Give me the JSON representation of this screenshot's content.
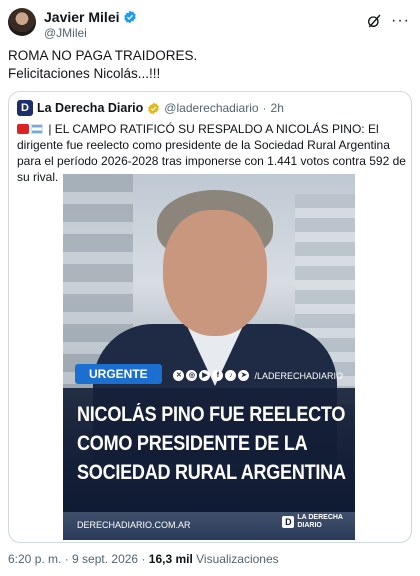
{
  "author": {
    "name": "Javier Milei",
    "handle": "@JMilei",
    "verified_color": "#1d9bf0"
  },
  "tweet": {
    "lines": [
      "ROMA NO PAGA TRAIDORES.",
      "Felicitaciones Nicolás...!!!"
    ]
  },
  "icons": {
    "grok": "grok-icon",
    "more": "more-icon",
    "verified": "verified-badge-icon"
  },
  "quote": {
    "name": "La Derecha Diario",
    "handle": "@laderechadiario",
    "separator": "·",
    "time": "2h",
    "badge_color": "#e2b719",
    "logo_letter": "D",
    "text": "| EL CAMPO RATIFICÓ SU RESPALDO A NICOLÁS PINO: El dirigente fue reelecto como presidente de la Sociedad Rural Argentina para el período 2026-2028 tras imponerse con 1.441 votos contra 592 de su rival.",
    "media": {
      "tag": "URGENTE",
      "social_handle": "/LADERECHADIARIO",
      "headline": [
        "NICOLÁS PINO FUE REELECTO",
        "COMO PRESIDENTE DE LA",
        "SOCIEDAD RURAL ARGENTINA"
      ],
      "site": "DERECHADIARIO.COM.AR",
      "brand_mark": "D",
      "brand_line1": "LA DERECHA",
      "brand_line2": "DIARIO",
      "accent": "#1a6fd1"
    }
  },
  "meta": {
    "time": "6:20 p. m.",
    "sep1": " · ",
    "date": "9 sept. 2026",
    "sep2": " · ",
    "views_count": "16,3 mil",
    "views_label": " Visualizaciones"
  }
}
